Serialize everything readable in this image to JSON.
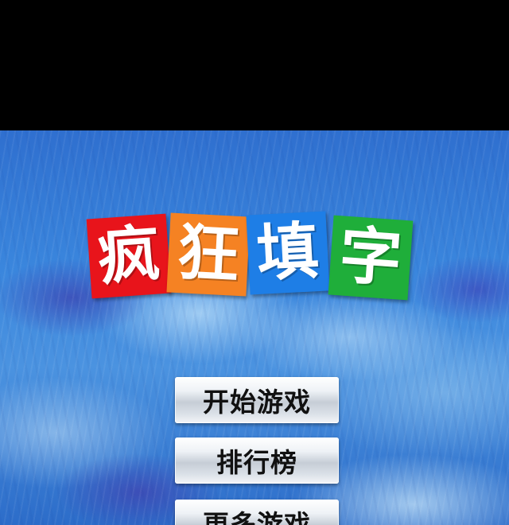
{
  "title": {
    "tiles": [
      {
        "char": "疯",
        "color": "#e8141b"
      },
      {
        "char": "狂",
        "color": "#f58223"
      },
      {
        "char": "填",
        "color": "#1e7ee6"
      },
      {
        "char": "字",
        "color": "#1fae3a"
      }
    ]
  },
  "menu": {
    "buttons": [
      {
        "label": "开始游戏"
      },
      {
        "label": "排行榜"
      },
      {
        "label": "更多游戏"
      }
    ]
  }
}
